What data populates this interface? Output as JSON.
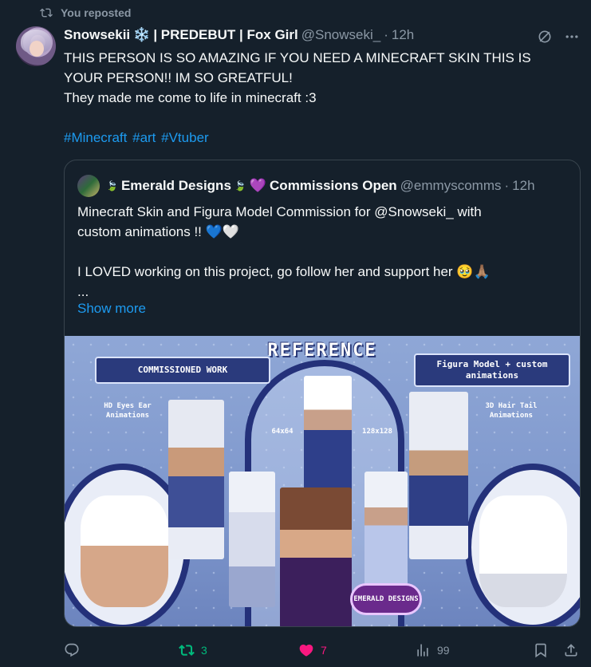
{
  "repost_banner": {
    "text": "You reposted",
    "icon": "repost-icon"
  },
  "author": {
    "name": "Snowsekii",
    "name_emoji": "❄️",
    "name_suffix": "| PREDEBUT | Fox Girl",
    "handle": "@Snowseki_",
    "separator": "·",
    "time": "12h"
  },
  "tweet": {
    "lines": [
      "THIS PERSON IS SO AMAZING IF YOU NEED A MINECRAFT SKIN THIS IS",
      "YOUR PERSON!! IM SO GREATFUL!",
      "They made me come to life in minecraft :3"
    ],
    "hashtags": [
      "#Minecraft",
      "#art",
      "#Vtuber"
    ]
  },
  "quote": {
    "name_prefix_emoji": "🍃",
    "name": "Emerald Designs",
    "name_mid_emoji": "🍃",
    "heart": "💜",
    "name_suffix": "Commissions Open",
    "handle": "@emmyscomms",
    "separator": "·",
    "time": "12h",
    "line1": "Minecraft Skin and Figura Model Commission for @Snowseki_ with",
    "line2": "custom animations !! 💙🤍",
    "line3": "I LOVED working on this project, go follow her and support her 🥹🙏🏽",
    "line4": "...",
    "show_more": "Show more",
    "media": {
      "title": "REFERENCE",
      "banner_left": "COMMISSIONED WORK",
      "banner_right": "Figura Model + custom animations",
      "tag_hd": "HD Eyes Ear Animations",
      "tag_64": "64x64",
      "tag_128": "128x128",
      "tag_3d": "3D Hair Tail Animations",
      "logo": "EMERALD DESIGNS"
    }
  },
  "actions": {
    "reply_count": "",
    "repost_count": "3",
    "like_count": "7",
    "views_count": "99"
  },
  "colors": {
    "background": "#15202b",
    "accent": "#1d9bf0",
    "repost_active": "#00ba7c",
    "like_active": "#f91880",
    "muted": "#8b98a5"
  }
}
